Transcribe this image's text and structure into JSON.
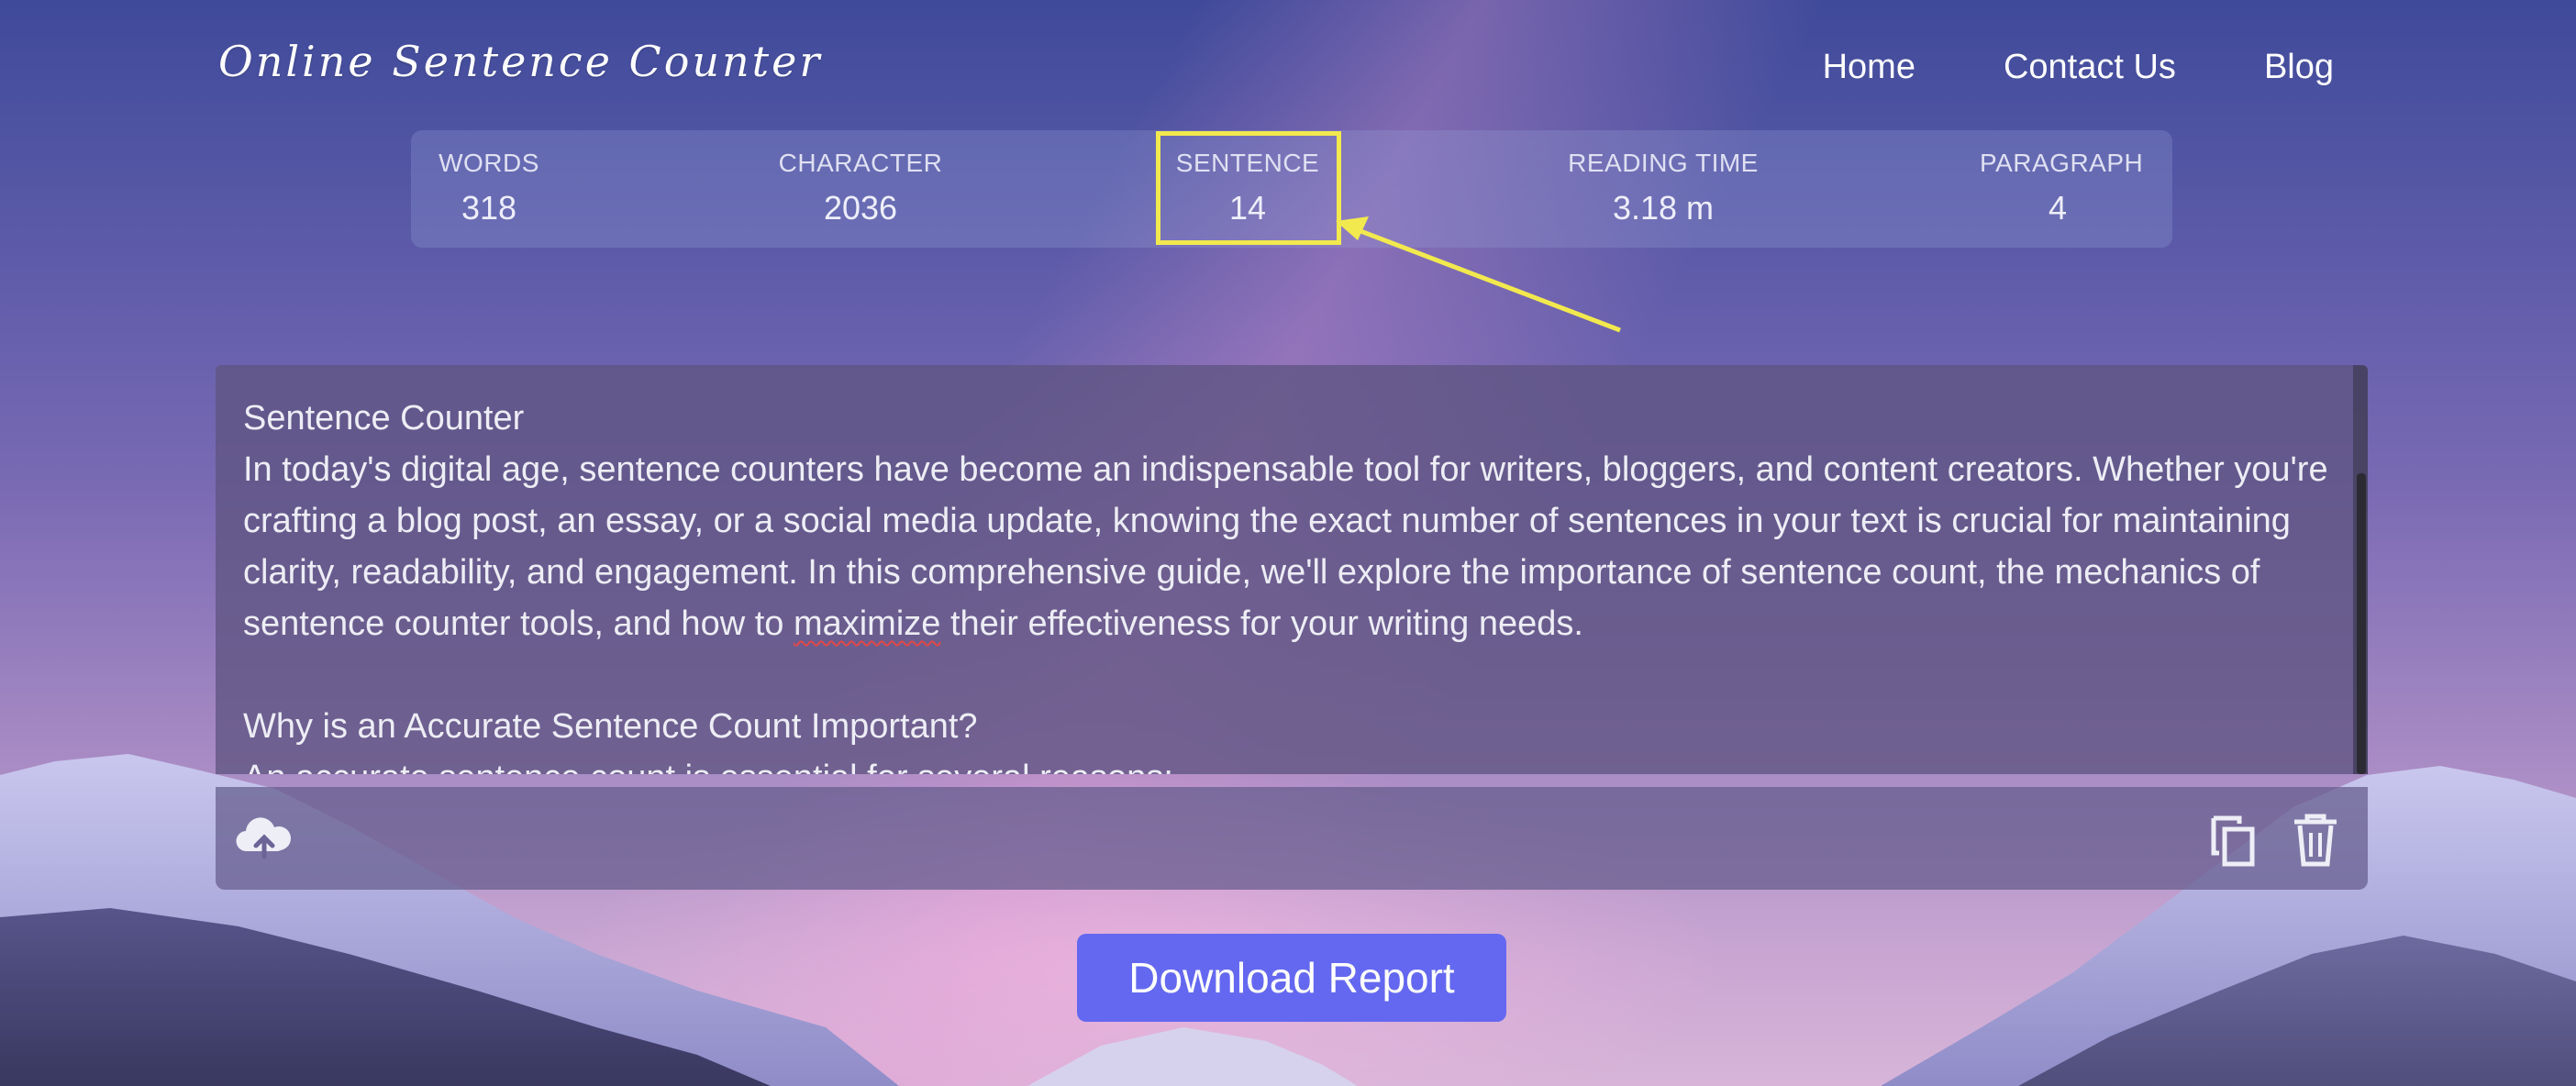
{
  "header": {
    "brand": "Online Sentence Counter",
    "nav": [
      "Home",
      "Contact Us",
      "Blog"
    ]
  },
  "stats": [
    {
      "label": "WORDS",
      "value": "318"
    },
    {
      "label": "CHARACTER",
      "value": "2036"
    },
    {
      "label": "SENTENCE",
      "value": "14"
    },
    {
      "label": "READING TIME",
      "value": "3.18 m"
    },
    {
      "label": "PARAGRAPH",
      "value": "4"
    }
  ],
  "editor": {
    "title": "Sentence Counter",
    "para1_before": "In today's digital age, sentence counters have become an indispensable tool for writers, bloggers, and content creators. Whether you're crafting a blog post, an essay, or a social media update, knowing the exact number of sentences in your text is crucial for maintaining clarity, readability, and engagement. In this comprehensive guide, we'll explore the importance of sentence count, the mechanics of sentence counter tools, and how to ",
    "para1_flagged": "maximize",
    "para1_after": " their effectiveness for your writing needs.",
    "heading2": "Why is an Accurate Sentence Count Important?",
    "line_partial": "An accurate sentence count is essential for several reasons:"
  },
  "toolbar": {
    "upload_icon": "cloud-upload-icon",
    "copy_icon": "copy-icon",
    "delete_icon": "trash-icon"
  },
  "download_label": "Download Report",
  "colors": {
    "highlight": "#f2e94e",
    "button": "#6468f0",
    "spell_underline": "#e04848"
  }
}
